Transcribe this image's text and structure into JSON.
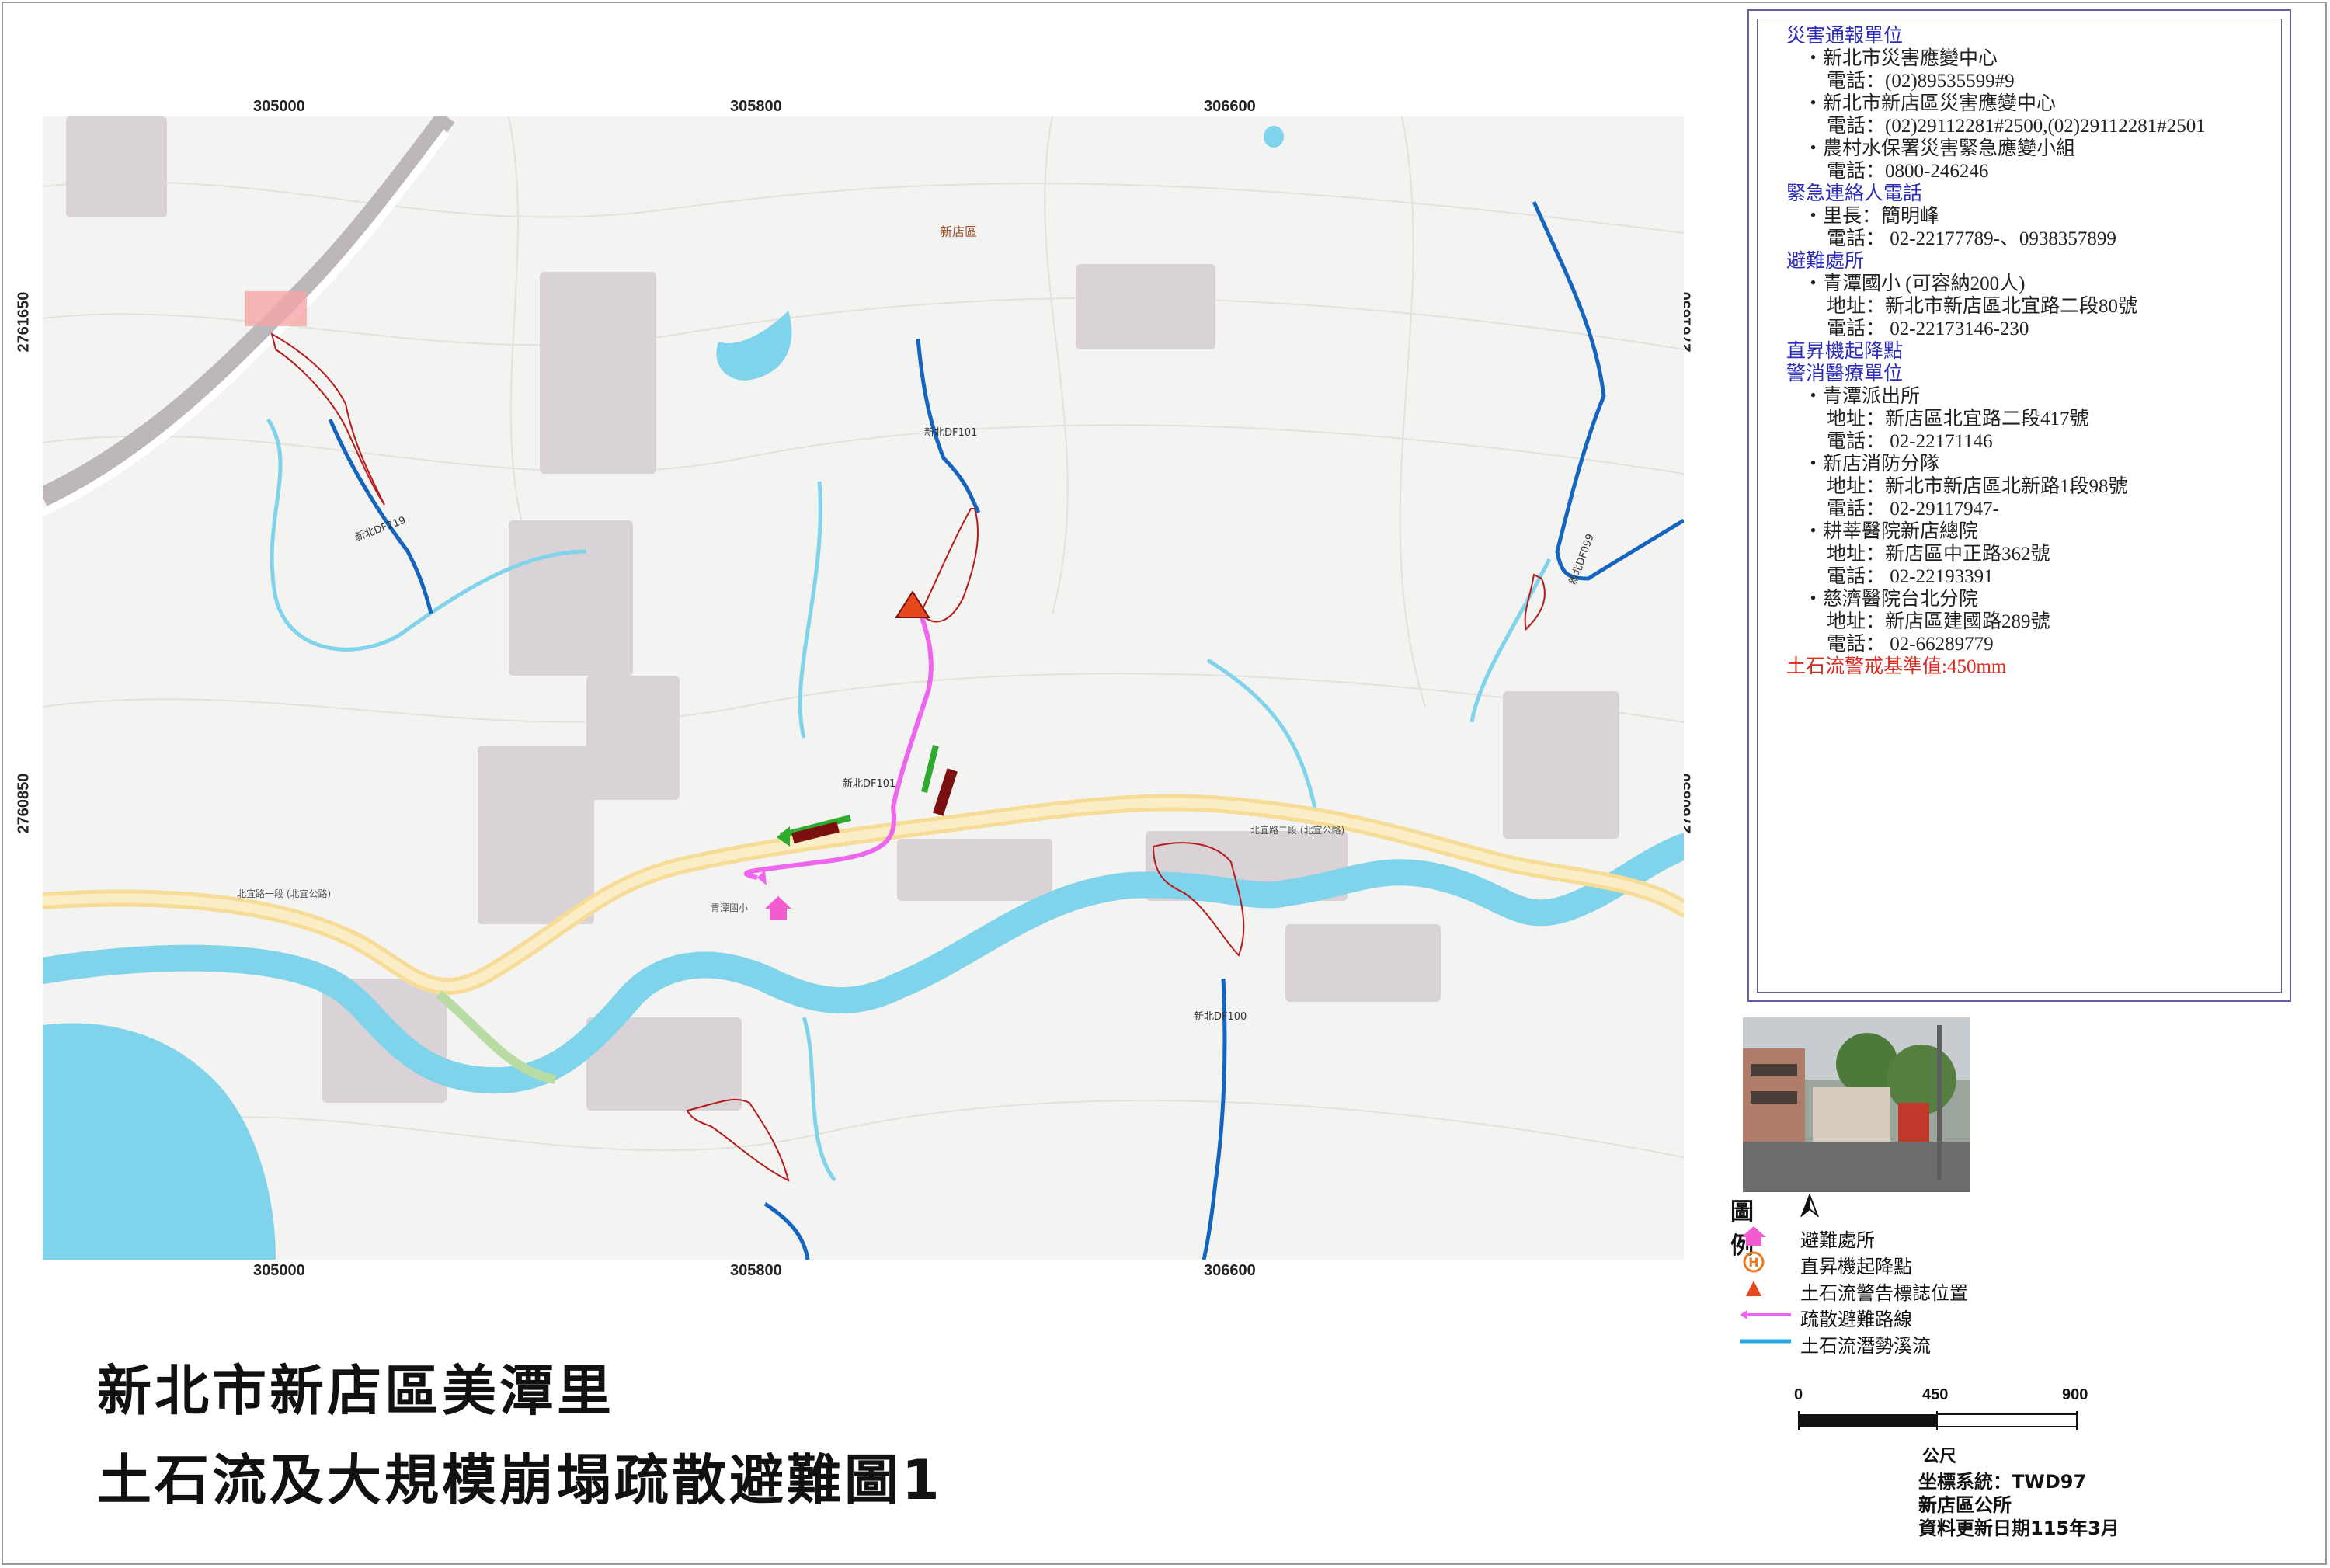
{
  "map": {
    "grid_x_labels": [
      "305000",
      "305800",
      "306600"
    ],
    "grid_y_labels": [
      "2761650",
      "2760850"
    ],
    "place_labels": {
      "district": "新店區",
      "stream_101": "新北DF101",
      "stream_101b": "新北DF101",
      "stream_099": "新北DF099",
      "stream_100": "新北DF100",
      "stream_219": "新北DF219",
      "road_beiyi": "北宜路二段 (北宜公路)",
      "road_beiyi_w": "北宜路一段 (北宜公路)",
      "school": "青潭國小",
      "evac_label": "疏散避難路線"
    }
  },
  "info": {
    "sections": [
      {
        "heading": "災害通報單位",
        "lines": [
          {
            "t": "・新北市災害應變中心",
            "k": "l"
          },
          {
            "t": "電話：(02)89535599#9",
            "k": "s"
          },
          {
            "t": "・新北市新店區災害應變中心",
            "k": "l"
          },
          {
            "t": "電話：(02)29112281#2500,(02)29112281#2501",
            "k": "s"
          },
          {
            "t": "・農村水保署災害緊急應變小組",
            "k": "l"
          },
          {
            "t": "電話：0800-246246",
            "k": "s"
          }
        ]
      },
      {
        "heading": "緊急連絡人電話",
        "lines": [
          {
            "t": "・里長：簡明峰",
            "k": "l"
          },
          {
            "t": "電話： 02-22177789-、0938357899",
            "k": "s"
          }
        ]
      },
      {
        "heading": "避難處所",
        "lines": [
          {
            "t": "・青潭國小 (可容納200人)",
            "k": "l"
          },
          {
            "t": "地址：新北市新店區北宜路二段80號",
            "k": "s"
          },
          {
            "t": "電話： 02-22173146-230",
            "k": "s"
          }
        ]
      },
      {
        "heading": "直昇機起降點",
        "lines": []
      },
      {
        "heading": "警消醫療單位",
        "lines": [
          {
            "t": "・青潭派出所",
            "k": "l"
          },
          {
            "t": "地址：新店區北宜路二段417號",
            "k": "s"
          },
          {
            "t": "電話： 02-22171146",
            "k": "s"
          },
          {
            "t": "・新店消防分隊",
            "k": "l"
          },
          {
            "t": "地址：新北市新店區北新路1段98號",
            "k": "s"
          },
          {
            "t": "電話： 02-29117947-",
            "k": "s"
          },
          {
            "t": "・耕莘醫院新店總院",
            "k": "l"
          },
          {
            "t": "地址：新店區中正路362號",
            "k": "s"
          },
          {
            "t": "電話： 02-22193391",
            "k": "s"
          },
          {
            "t": "・慈濟醫院台北分院",
            "k": "l"
          },
          {
            "t": "地址：新店區建國路289號",
            "k": "s"
          },
          {
            "t": "電話： 02-66289779",
            "k": "s"
          }
        ]
      }
    ],
    "warning": "土石流警戒基準值:450mm"
  },
  "legend": {
    "title": "圖例",
    "items": [
      {
        "label": "避難處所",
        "icon": "shelter-house-icon"
      },
      {
        "label": "直昇機起降點",
        "icon": "helipad-icon"
      },
      {
        "label": "土石流警告標誌位置",
        "icon": "warning-triangle-icon"
      },
      {
        "label": "疏散避難路線",
        "icon": "evacuation-arrow-icon"
      },
      {
        "label": "土石流潛勢溪流",
        "icon": "debris-stream-line-icon"
      }
    ]
  },
  "scale": {
    "labels": [
      "0",
      "450",
      "900"
    ],
    "unit": "公尺"
  },
  "meta": {
    "crs": "坐標系統：TWD97",
    "office": "新店區公所",
    "updated": "資料更新日期115年3月"
  },
  "title": {
    "line1": "新北市新店區美潭里",
    "line2": "土石流及大規模崩塌疏散避難圖1"
  },
  "colors": {
    "river": "#7fd3ea",
    "stream": "#1565c0",
    "route": "#ee66ee",
    "warning": "#e8471c",
    "heading": "#2b2bb8",
    "collapse": "#b71c1c"
  }
}
